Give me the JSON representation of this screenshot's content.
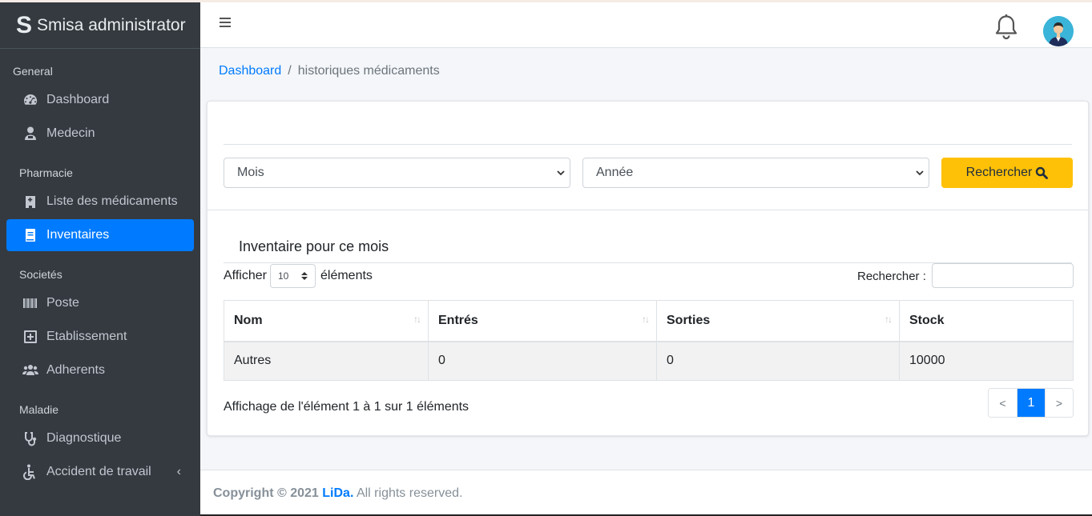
{
  "brand": {
    "logo": "S",
    "name": "Smisa administrator"
  },
  "sidebar": {
    "sections": [
      {
        "header": "General",
        "items": [
          {
            "label": "Dashboard",
            "icon": "tachometer-icon"
          },
          {
            "label": "Medecin",
            "icon": "user-doctor-icon"
          }
        ]
      },
      {
        "header": "Pharmacie",
        "items": [
          {
            "label": "Liste des médicaments",
            "icon": "hospital-icon"
          },
          {
            "label": "Inventaires",
            "icon": "book-icon",
            "active": true
          }
        ]
      },
      {
        "header": "Societés",
        "items": [
          {
            "label": "Poste",
            "icon": "barcode-icon"
          },
          {
            "label": "Etablissement",
            "icon": "plus-square-icon"
          },
          {
            "label": "Adherents",
            "icon": "users-icon"
          }
        ]
      },
      {
        "header": "Maladie",
        "items": [
          {
            "label": "Diagnostique",
            "icon": "stethoscope-icon"
          },
          {
            "label": "Accident de travail",
            "icon": "wheelchair-icon",
            "caret": "‹"
          }
        ]
      }
    ]
  },
  "header": {
    "menu_icon": "hamburger-icon",
    "notification_icon": "bell-icon",
    "avatar_icon": "user-avatar-icon"
  },
  "breadcrumb": {
    "home": "Dashboard",
    "separator": "/",
    "current": "historiques médicaments"
  },
  "filters": {
    "month": {
      "value": "Mois"
    },
    "year": {
      "value": "Année"
    },
    "search_button": "Rechercher"
  },
  "inventory": {
    "title": "Inventaire pour ce mois",
    "length_prefix": "Afficher",
    "length_value": "10",
    "length_suffix": "éléments",
    "search_label": "Rechercher :",
    "columns": [
      "Nom",
      "Entrés",
      "Sorties",
      "Stock"
    ],
    "rows": [
      [
        "Autres",
        "0",
        "0",
        "10000"
      ]
    ],
    "info": "Affichage de l'élément 1 à 1 sur 1 éléments",
    "pagination": {
      "prev": "<",
      "current": "1",
      "next": ">"
    }
  },
  "footer": {
    "prefix": "Copyright © 2021 ",
    "brand": "LiDa.",
    "suffix": " All rights reserved."
  },
  "colors": {
    "sidebar": "#343a40",
    "active": "#007bff",
    "search_button": "#ffc107",
    "background": "#f4f6f9"
  }
}
